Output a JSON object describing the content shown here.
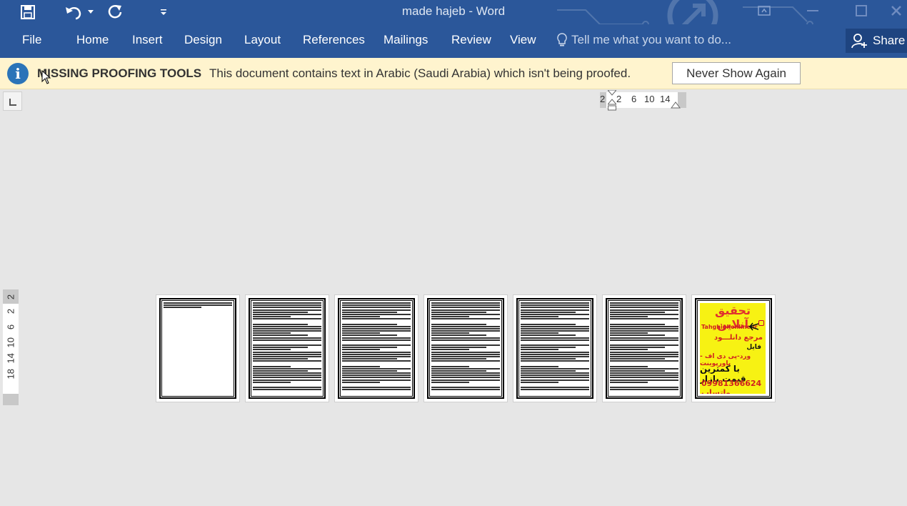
{
  "titlebar": {
    "title": "made hajeb - Word",
    "qat": [
      {
        "name": "save-icon"
      },
      {
        "name": "undo-icon"
      },
      {
        "name": "undo-dropdown-icon"
      },
      {
        "name": "redo-icon"
      },
      {
        "name": "customize-qat-icon"
      }
    ],
    "window_controls": [
      "ribbon-display-options-icon",
      "minimize-icon",
      "maximize-icon",
      "close-icon"
    ]
  },
  "ribbon": {
    "tabs": [
      "File",
      "Home",
      "Insert",
      "Design",
      "Layout",
      "References",
      "Mailings",
      "Review",
      "View"
    ],
    "tell_me_placeholder": "Tell me what you want to do...",
    "share_label": "Share"
  },
  "message_bar": {
    "title": "MISSING PROOFING TOOLS",
    "text": "This document contains text in Arabic (Saudi Arabia) which isn't being proofed.",
    "button_label": "Never Show Again"
  },
  "horizontal_ruler": {
    "ticks": [
      "2",
      "2",
      "6",
      "10",
      "14"
    ]
  },
  "vertical_ruler": {
    "ticks": [
      "2",
      "2",
      "6",
      "10",
      "14",
      "18"
    ]
  },
  "pages": {
    "count": 7,
    "ad_page": {
      "line1": "تحقیق آنلاین",
      "line2": "Tahghighonline.ir",
      "line3": "مرجع دانلـــود",
      "line4": "فایل",
      "line5": "ورد-پی دی اف - پاورپوینت",
      "line6": "با کمترین قیمت بازار",
      "line7": "09981366624 واتساپ"
    }
  },
  "colors": {
    "ribbon_blue": "#2b579a",
    "message_bar": "#fff4ce",
    "canvas": "#e6e6e6",
    "ad_yellow": "#f7f213",
    "ad_red": "#e0302f"
  }
}
